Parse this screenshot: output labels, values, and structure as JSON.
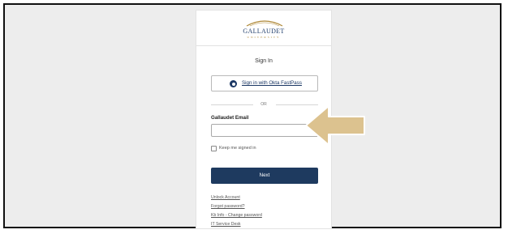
{
  "logo": {
    "name": "GALLAUDET",
    "sub": "UNIVERSITY"
  },
  "signin": {
    "title": "Sign In",
    "okta_label": "Sign in with Okta FastPass",
    "or_text": "OR",
    "email_label": "Gallaudet Email",
    "email_value": "",
    "keep_label": "Keep me signed in",
    "keep_checked": false,
    "next_label": "Next"
  },
  "links": [
    "Unlock Account",
    "Forgot password?",
    "Kb Info - Change password",
    "IT Service Desk"
  ],
  "colors": {
    "navy": "#1e3a5f",
    "gold_arrow": "#dcc28f",
    "background": "#ededed"
  },
  "icons": {
    "okta": "okta-fastpass-icon",
    "arrow": "arrow-left-annotation"
  }
}
